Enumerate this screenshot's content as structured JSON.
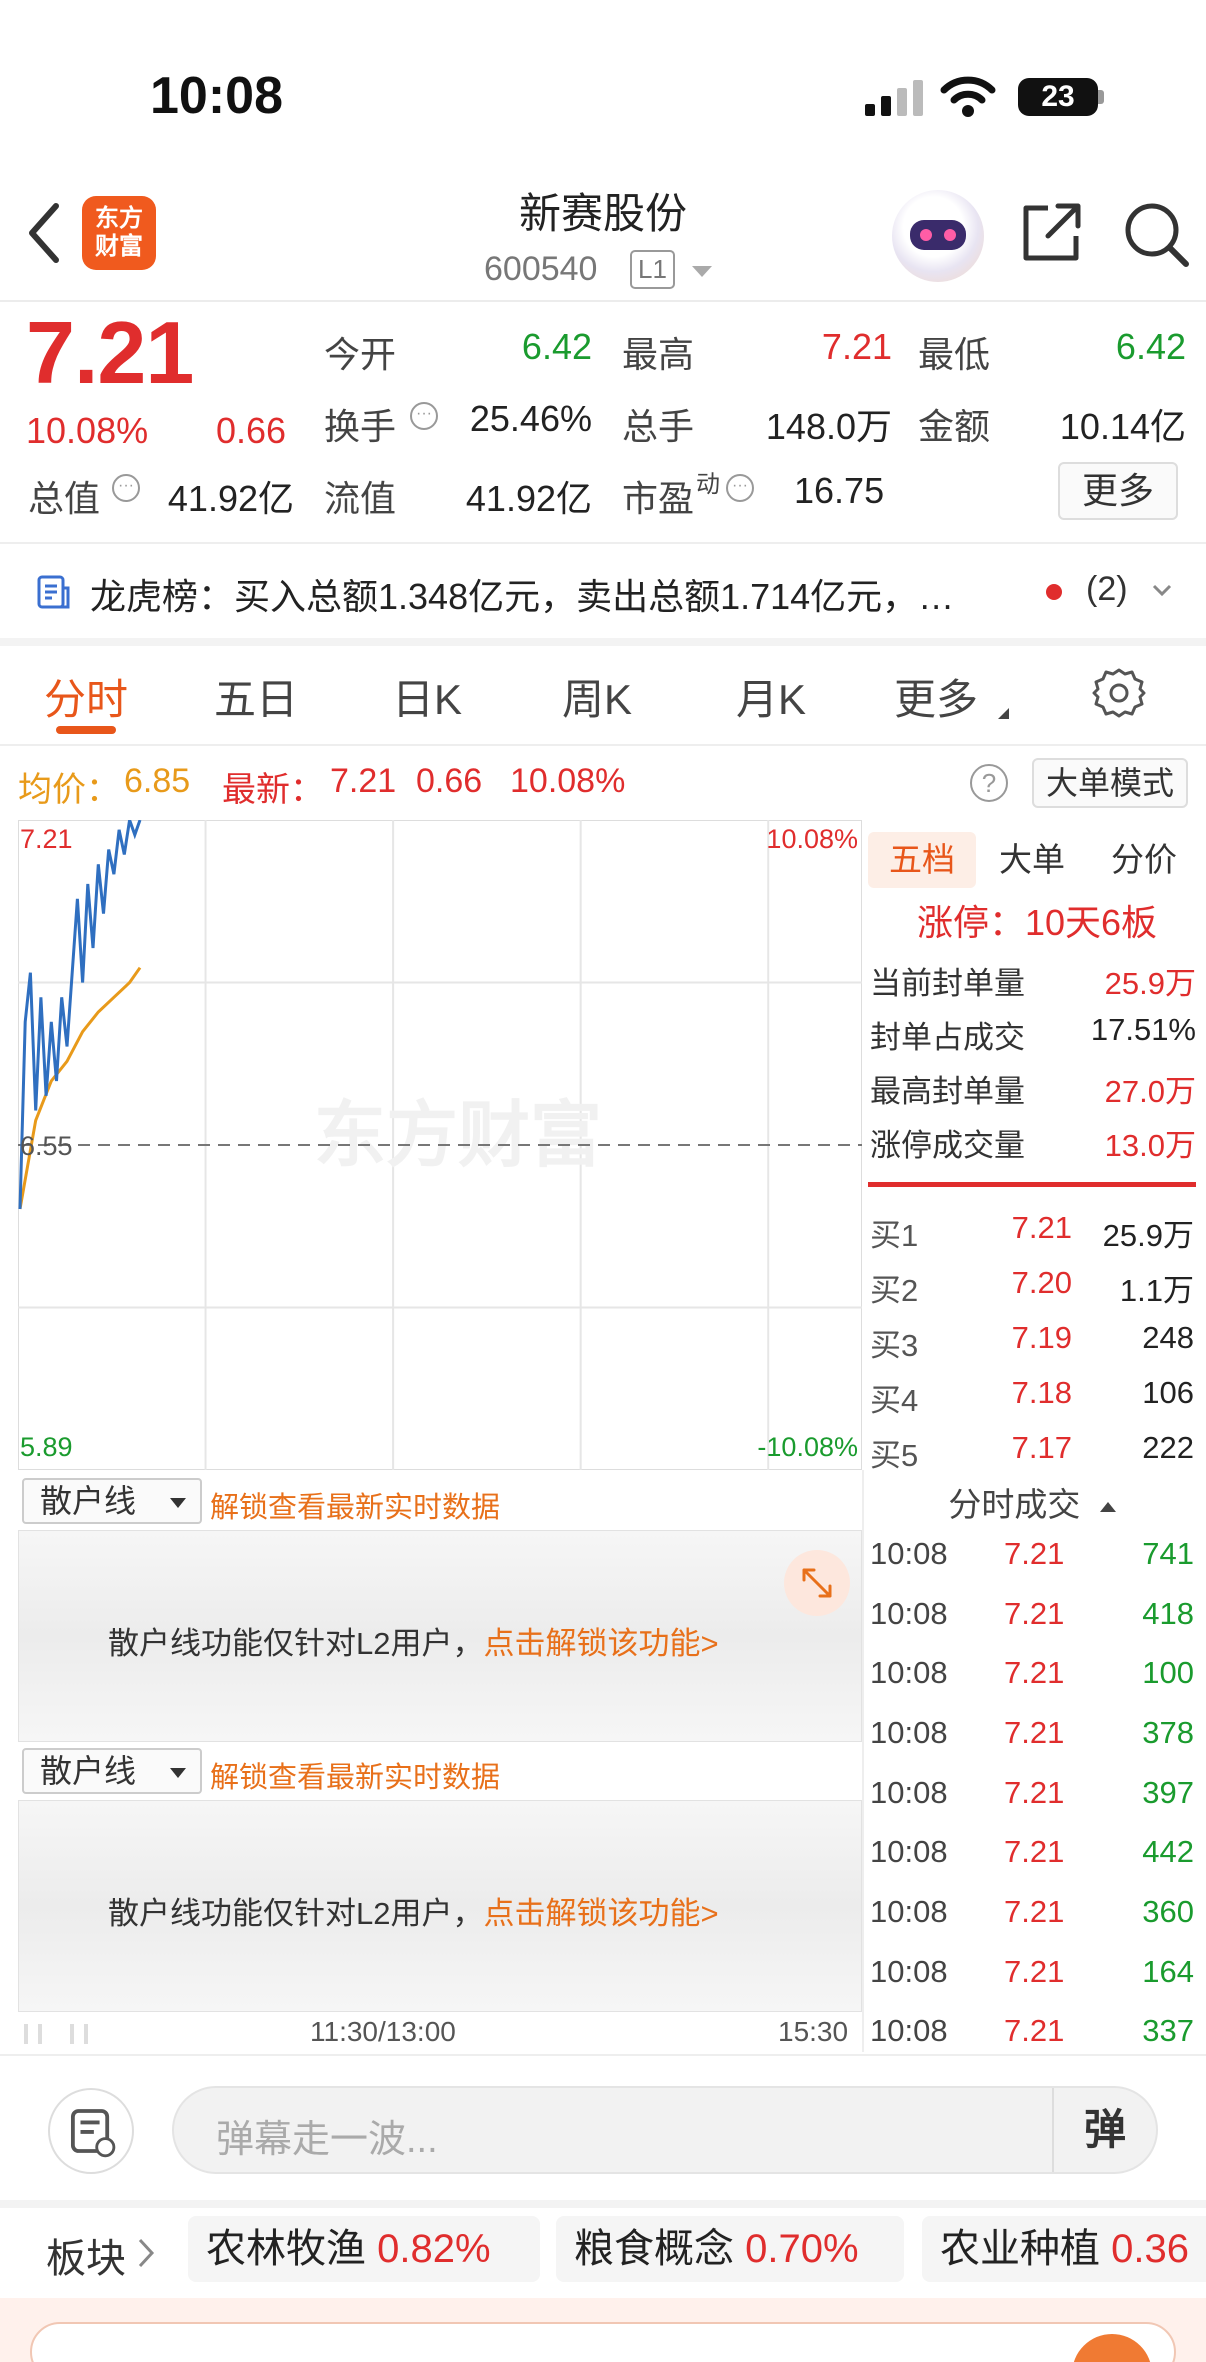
{
  "status": {
    "time": "10:08",
    "battery": "23"
  },
  "header": {
    "logo_line1": "东方",
    "logo_line2": "财富",
    "title": "新赛股份",
    "code": "600540",
    "level": "L1"
  },
  "quote": {
    "price": "7.21",
    "pct": "10.08%",
    "change": "0.66",
    "open_label": "今开",
    "open": "6.42",
    "high_label": "最高",
    "high": "7.21",
    "low_label": "最低",
    "low": "6.42",
    "turnover_label": "换手",
    "turnover": "25.46%",
    "volume_label": "总手",
    "volume": "148.0万",
    "amount_label": "金额",
    "amount": "10.14亿",
    "mktcap_label": "总值",
    "mktcap": "41.92亿",
    "float_label": "流值",
    "float": "41.92亿",
    "pe_label": "市盈",
    "pe_sup": "动",
    "pe": "16.75",
    "more_label": "更多",
    "info_dot": "···"
  },
  "dragon": {
    "text": "龙虎榜：买入总额1.348亿元，卖出总额1.714亿元，…",
    "count": "(2)"
  },
  "tabs": [
    "分时",
    "五日",
    "日K",
    "周K",
    "月K",
    "更多"
  ],
  "info_row": {
    "avg_label": "均价：",
    "avg": "6.85",
    "latest_label": "最新：",
    "latest": "7.21",
    "latest_chg": "0.66",
    "latest_pct": "10.08%",
    "help": "?",
    "mode_button": "大单模式"
  },
  "chart_data": {
    "type": "line",
    "y_labels": {
      "top": "7.21",
      "mid": "6.55",
      "bottom": "5.89",
      "top_pct": "10.08%",
      "bottom_pct": "-10.08%"
    },
    "ylim": [
      5.89,
      7.21
    ],
    "reference": 6.55,
    "watermark": "东方财富",
    "series": [
      {
        "color": "#2f6fc0",
        "points": [
          [
            0,
            6.42
          ],
          [
            1,
            6.8
          ],
          [
            2,
            6.9
          ],
          [
            3,
            6.62
          ],
          [
            4,
            6.85
          ],
          [
            5,
            6.65
          ],
          [
            6,
            6.8
          ],
          [
            7,
            6.68
          ],
          [
            8,
            6.85
          ],
          [
            9,
            6.75
          ],
          [
            10,
            6.9
          ],
          [
            11,
            7.05
          ],
          [
            12,
            6.88
          ],
          [
            13,
            7.08
          ],
          [
            14,
            6.95
          ],
          [
            15,
            7.12
          ],
          [
            16,
            7.02
          ],
          [
            17,
            7.15
          ],
          [
            18,
            7.1
          ],
          [
            19,
            7.19
          ],
          [
            20,
            7.14
          ],
          [
            21,
            7.21
          ],
          [
            22,
            7.18
          ],
          [
            23,
            7.21
          ]
        ]
      },
      {
        "color": "#e89a1a",
        "points": [
          [
            0,
            6.42
          ],
          [
            3,
            6.6
          ],
          [
            6,
            6.68
          ],
          [
            9,
            6.72
          ],
          [
            12,
            6.78
          ],
          [
            15,
            6.82
          ],
          [
            18,
            6.85
          ],
          [
            21,
            6.88
          ],
          [
            23,
            6.91
          ]
        ]
      }
    ],
    "x_ticks": [
      "11:30/13:00",
      "15:30"
    ]
  },
  "right_panel": {
    "tabs": [
      "五档",
      "大单",
      "分价"
    ],
    "limit_text": "涨停：10天6板",
    "stats": [
      {
        "label": "当前封单量",
        "value": "25.9万",
        "color": "red"
      },
      {
        "label": "封单占成交",
        "value": "17.51%",
        "color": "black"
      },
      {
        "label": "最高封单量",
        "value": "27.0万",
        "color": "red"
      },
      {
        "label": "涨停成交量",
        "value": "13.0万",
        "color": "red"
      }
    ],
    "bids": [
      {
        "label": "买1",
        "price": "7.21",
        "vol": "25.9万"
      },
      {
        "label": "买2",
        "price": "7.20",
        "vol": "1.1万"
      },
      {
        "label": "买3",
        "price": "7.19",
        "vol": "248"
      },
      {
        "label": "买4",
        "price": "7.18",
        "vol": "106"
      },
      {
        "label": "买5",
        "price": "7.17",
        "vol": "222"
      }
    ],
    "trades_title": "分时成交",
    "trades": [
      {
        "t": "10:08",
        "p": "7.21",
        "v": "741"
      },
      {
        "t": "10:08",
        "p": "7.21",
        "v": "418"
      },
      {
        "t": "10:08",
        "p": "7.21",
        "v": "100"
      },
      {
        "t": "10:08",
        "p": "7.21",
        "v": "378"
      },
      {
        "t": "10:08",
        "p": "7.21",
        "v": "397"
      },
      {
        "t": "10:08",
        "p": "7.21",
        "v": "442"
      },
      {
        "t": "10:08",
        "p": "7.21",
        "v": "360"
      },
      {
        "t": "10:08",
        "p": "7.21",
        "v": "164"
      },
      {
        "t": "10:08",
        "p": "7.21",
        "v": "337"
      }
    ]
  },
  "sanhu": {
    "select_label": "散户线",
    "unlock_link": "解锁查看最新实时数据",
    "msg": "散户线功能仅针对L2用户，",
    "msg_link": "点击解锁该功能>"
  },
  "comment": {
    "placeholder": "弹幕走一波...",
    "dan": "弹"
  },
  "sectors": {
    "label": "板块",
    "chips": [
      {
        "name": "农林牧渔",
        "pct": "0.82%"
      },
      {
        "name": "粮食概念",
        "pct": "0.70%"
      },
      {
        "name": "农业种植",
        "pct": "0.36"
      }
    ]
  }
}
